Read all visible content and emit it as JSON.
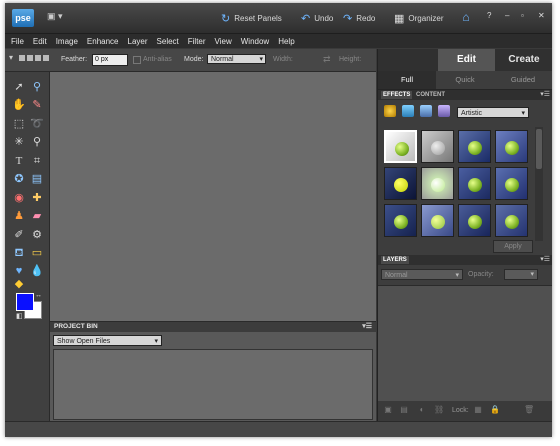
{
  "app": {
    "logo_text": "pse",
    "workspace_icon": "workspace-menu-icon"
  },
  "titlebar": {
    "reset_panels": "Reset Panels",
    "undo": "Undo",
    "redo": "Redo",
    "organizer": "Organizer",
    "home_icon": "home-icon",
    "window_controls": {
      "help": "?",
      "minimize": "–",
      "maximize": "▫",
      "close": "✕"
    }
  },
  "menu": [
    "File",
    "Edit",
    "Image",
    "Enhance",
    "Layer",
    "Select",
    "Filter",
    "View",
    "Window",
    "Help"
  ],
  "options": {
    "feather_label": "Feather:",
    "feather_value": "0 px",
    "antialias_label": "Anti-alias",
    "mode_label": "Mode:",
    "mode_value": "Normal",
    "width_label": "Width:",
    "height_label": "Height:"
  },
  "mode_tabs": {
    "edit": "Edit",
    "create": "Create"
  },
  "sub_tabs": {
    "full": "Full",
    "quick": "Quick",
    "guided": "Guided"
  },
  "effects": {
    "tab_effects": "EFFECTS",
    "tab_content": "CONTENT",
    "filter_value": "Artistic",
    "apply": "Apply",
    "thumb_count": 12
  },
  "layers": {
    "title": "LAYERS",
    "blend_value": "Normal",
    "opacity_label": "Opacity:",
    "lock_label": "Lock:"
  },
  "project_bin": {
    "title": "PROJECT BIN",
    "show_value": "Show Open Files"
  },
  "colors": {
    "foreground": "#0a10ff",
    "background": "#ffffff",
    "accent": "#6fb6ff"
  }
}
